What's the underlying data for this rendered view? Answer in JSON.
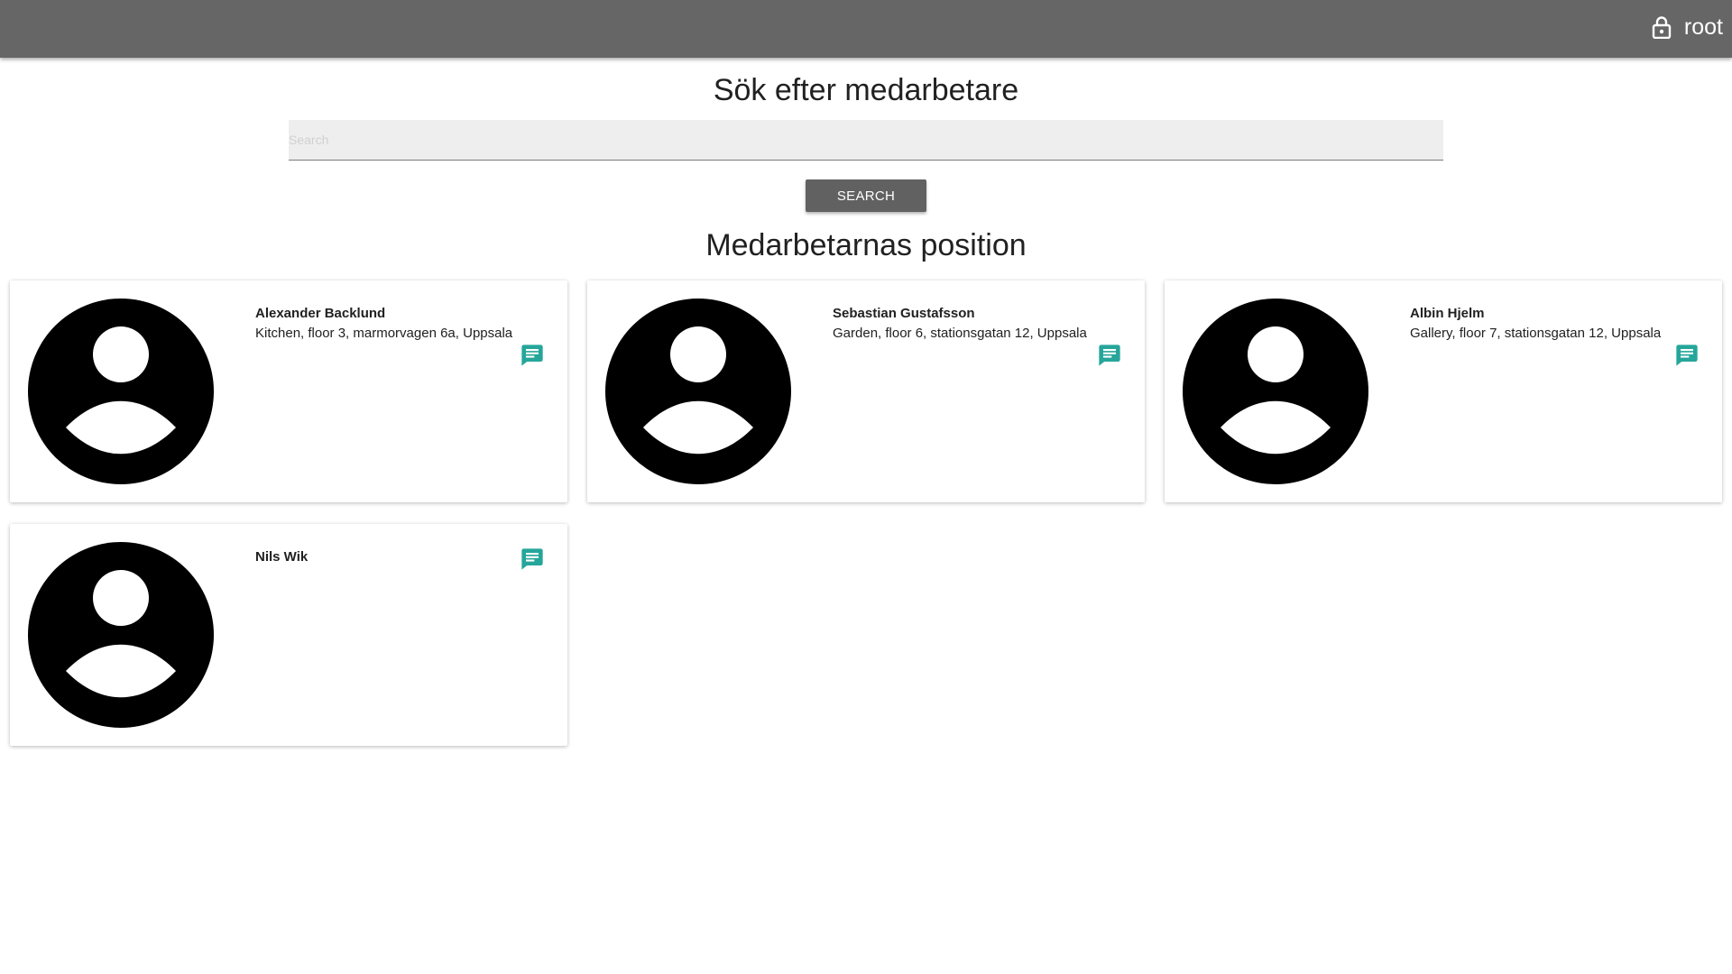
{
  "header": {
    "user": "root",
    "lock_icon": "lock-icon"
  },
  "search": {
    "title": "Sök efter medarbetare",
    "placeholder": "Search",
    "value": "",
    "button_label": "SEARCH"
  },
  "positions": {
    "title": "Medarbetarnas position",
    "employees": [
      {
        "name": "Alexander Backlund",
        "location": "Kitchen, floor 3, marmorvagen 6a, Uppsala"
      },
      {
        "name": "Sebastian Gustafsson",
        "location": "Garden, floor 6, stationsgatan 12, Uppsala"
      },
      {
        "name": "Albin Hjelm",
        "location": "Gallery, floor 7, stationsgatan 12, Uppsala"
      },
      {
        "name": "Nils Wik",
        "location": ""
      }
    ]
  },
  "colors": {
    "topbar": "#666666",
    "button": "#616161",
    "chat_icon": "#26a69a"
  }
}
